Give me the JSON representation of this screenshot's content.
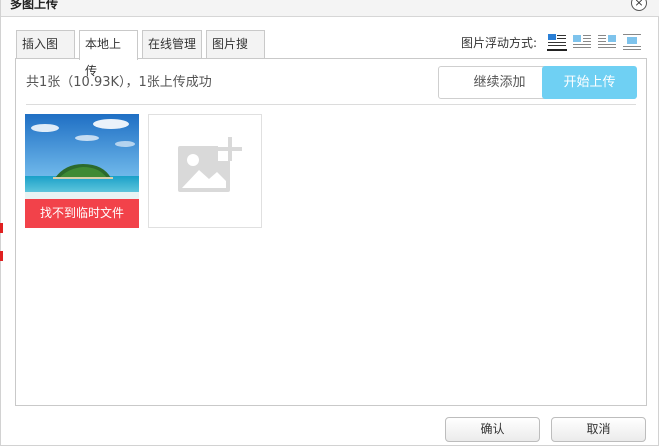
{
  "window": {
    "title": "多图上传"
  },
  "tabs": [
    {
      "label": "插入图片"
    },
    {
      "label": "本地上传"
    },
    {
      "label": "在线管理"
    },
    {
      "label": "图片搜索"
    }
  ],
  "float": {
    "label": "图片浮动方式:",
    "icons": [
      "float-none-icon",
      "float-left-icon",
      "float-right-icon",
      "float-center-icon"
    ]
  },
  "upload": {
    "status": "共1张（10.93K），1张上传成功",
    "continue_label": "继续添加",
    "start_label": "开始上传"
  },
  "thumbnail": {
    "error": "找不到临时文件"
  },
  "footer": {
    "ok_label": "确认",
    "cancel_label": "取消"
  },
  "colors": {
    "accent": "#6fd0f3",
    "error": "#f2424a"
  }
}
